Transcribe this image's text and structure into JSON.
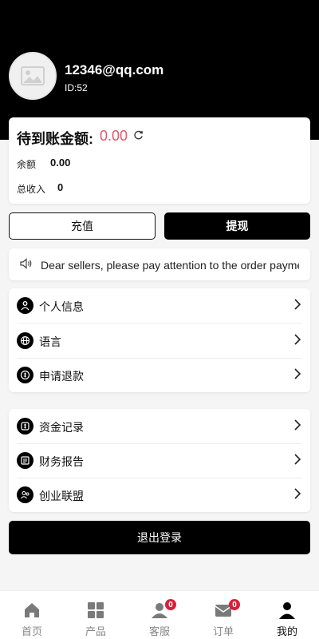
{
  "profile": {
    "email": "12346@qq.com",
    "id_text": "ID:52"
  },
  "balance": {
    "pending_label": "待到账金额:",
    "pending_value": "0.00",
    "rows": [
      {
        "label": "余额",
        "value": "0.00"
      },
      {
        "label": "总收入",
        "value": "0"
      }
    ]
  },
  "actions": {
    "recharge_label": "充值",
    "withdraw_label": "提现"
  },
  "notice": {
    "icon": "speaker-icon",
    "text": "Dear sellers, please pay attention to the order payment"
  },
  "menu_group_1": [
    {
      "label": "个人信息",
      "icon": "user-icon"
    },
    {
      "label": "语言",
      "icon": "globe-icon"
    },
    {
      "label": "申请退款",
      "icon": "refund-icon"
    }
  ],
  "menu_group_2": [
    {
      "label": "资金记录",
      "icon": "money-record-icon"
    },
    {
      "label": "财务报告",
      "icon": "report-icon"
    },
    {
      "label": "创业联盟",
      "icon": "alliance-icon"
    }
  ],
  "logout_label": "退出登录",
  "tabs": [
    {
      "label": "首页",
      "icon": "home-icon"
    },
    {
      "label": "产品",
      "icon": "grid-icon"
    },
    {
      "label": "客服",
      "icon": "support-icon",
      "badge": "0"
    },
    {
      "label": "订单",
      "icon": "mail-icon",
      "badge": "0"
    },
    {
      "label": "我的",
      "icon": "profile-icon",
      "active": true
    }
  ],
  "colors": {
    "accent_red": "#e0576b",
    "badge_red": "#d6203a",
    "header_bg": "#000000"
  }
}
